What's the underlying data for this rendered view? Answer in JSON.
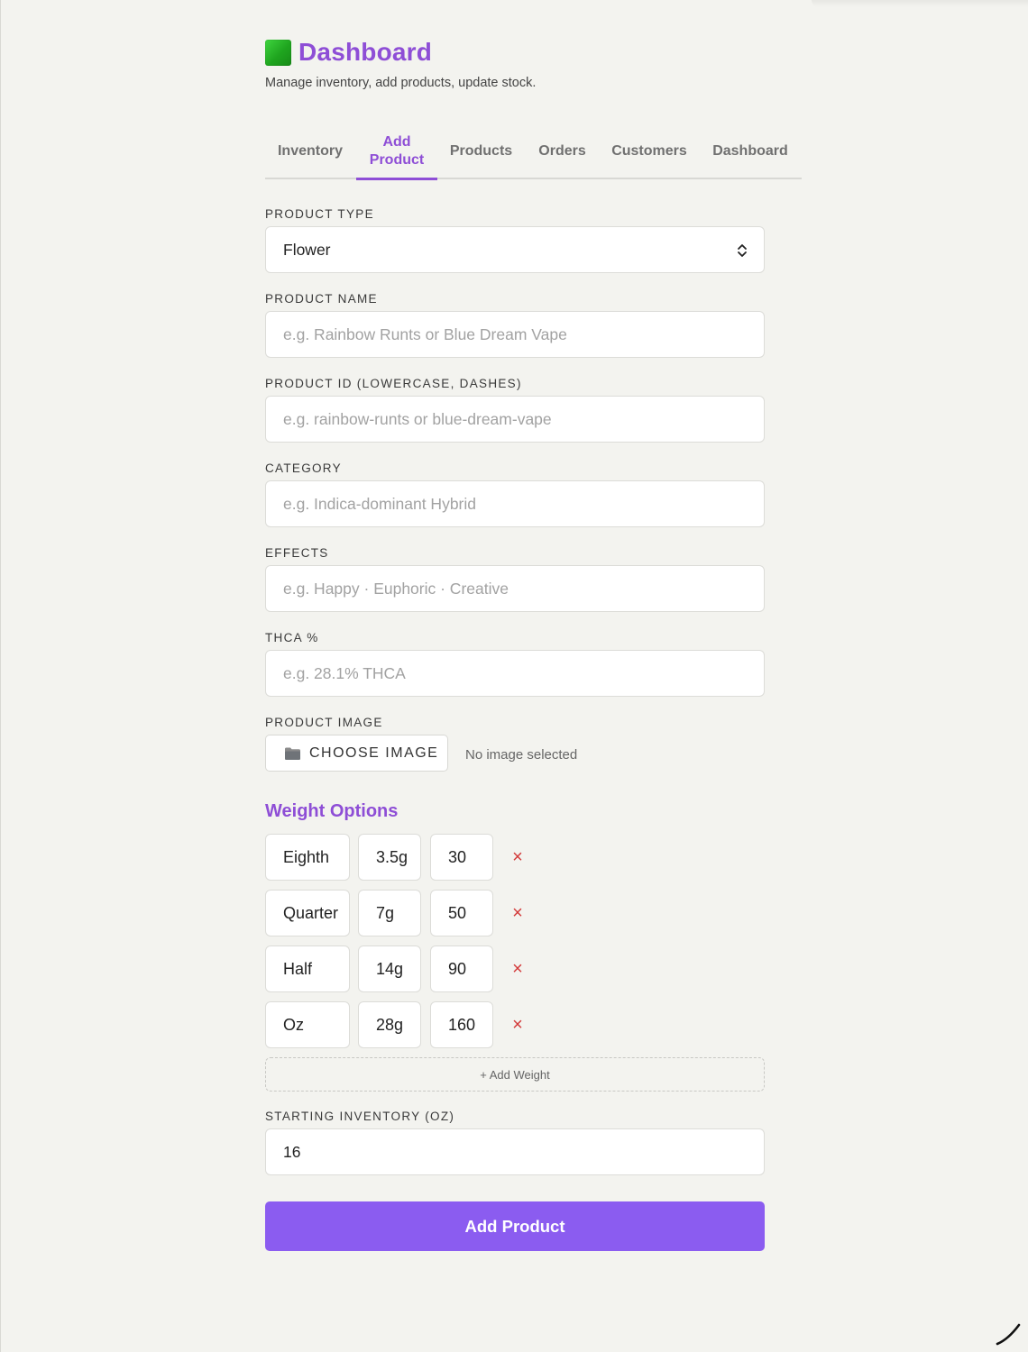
{
  "header": {
    "title": "Dashboard",
    "title_icon": "green-square-icon",
    "subtitle": "Manage inventory, add products, update stock."
  },
  "tabs": [
    {
      "label": "Inventory",
      "active": false
    },
    {
      "label": "Add Product",
      "active": true
    },
    {
      "label": "Products",
      "active": false
    },
    {
      "label": "Orders",
      "active": false
    },
    {
      "label": "Customers",
      "active": false
    },
    {
      "label": "Dashboard",
      "active": false
    }
  ],
  "form": {
    "product_type": {
      "label": "PRODUCT TYPE",
      "value": "Flower"
    },
    "product_name": {
      "label": "PRODUCT NAME",
      "placeholder": "e.g. Rainbow Runts or Blue Dream Vape"
    },
    "product_id": {
      "label": "PRODUCT ID (LOWERCASE, DASHES)",
      "placeholder": "e.g. rainbow-runts or blue-dream-vape"
    },
    "category": {
      "label": "CATEGORY",
      "placeholder": "e.g. Indica-dominant Hybrid"
    },
    "effects": {
      "label": "EFFECTS",
      "placeholder": "e.g. Happy · Euphoric · Creative"
    },
    "thca": {
      "label": "THCA %",
      "placeholder": "e.g. 28.1% THCA"
    },
    "product_image": {
      "label": "PRODUCT IMAGE",
      "button": "CHOOSE IMAGE",
      "button_icon": "folder-icon",
      "status": "No image selected"
    },
    "weight_options": {
      "title": "Weight Options",
      "rows": [
        {
          "name": "Eighth",
          "grams": "3.5g",
          "price": "30"
        },
        {
          "name": "Quarter",
          "grams": "7g",
          "price": "50"
        },
        {
          "name": "Half",
          "grams": "14g",
          "price": "90"
        },
        {
          "name": "Oz",
          "grams": "28g",
          "price": "160"
        }
      ],
      "remove_symbol": "×",
      "add_label": "+ Add Weight"
    },
    "starting_inventory": {
      "label": "STARTING INVENTORY (OZ)",
      "value": "16"
    },
    "submit_label": "Add Product"
  },
  "colors": {
    "accent": "#8e4ed6",
    "button": "#8b5cf0",
    "remove": "#d33a3a",
    "background": "#f3f3ef"
  }
}
